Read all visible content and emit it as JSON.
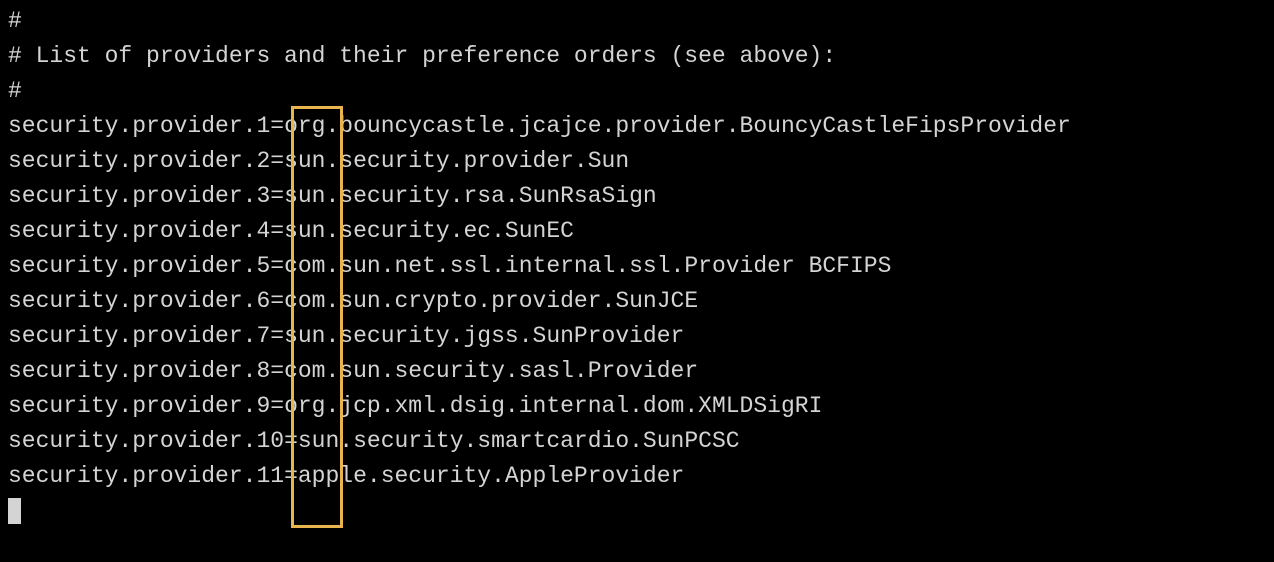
{
  "comments": {
    "line1": "#",
    "line2": "# List of providers and their preference orders (see above):",
    "line3": "#"
  },
  "providers": [
    {
      "key": "security.provider.",
      "num": "1",
      "sep": "=",
      "value": "org.bouncycastle.jcajce.provider.BouncyCastleFipsProvider"
    },
    {
      "key": "security.provider.",
      "num": "2",
      "sep": "=",
      "value": "sun.security.provider.Sun"
    },
    {
      "key": "security.provider.",
      "num": "3",
      "sep": "=",
      "value": "sun.security.rsa.SunRsaSign"
    },
    {
      "key": "security.provider.",
      "num": "4",
      "sep": "=",
      "value": "sun.security.ec.SunEC"
    },
    {
      "key": "security.provider.",
      "num": "5",
      "sep": "=",
      "value": "com.sun.net.ssl.internal.ssl.Provider BCFIPS"
    },
    {
      "key": "security.provider.",
      "num": "6",
      "sep": "=",
      "value": "com.sun.crypto.provider.SunJCE"
    },
    {
      "key": "security.provider.",
      "num": "7",
      "sep": "=",
      "value": "sun.security.jgss.SunProvider"
    },
    {
      "key": "security.provider.",
      "num": "8",
      "sep": "=",
      "value": "com.sun.security.sasl.Provider"
    },
    {
      "key": "security.provider.",
      "num": "9",
      "sep": "=",
      "value": "org.jcp.xml.dsig.internal.dom.XMLDSigRI"
    },
    {
      "key": "security.provider.",
      "num": "10",
      "sep": "=",
      "value": "sun.security.smartcardio.SunPCSC"
    },
    {
      "key": "security.provider.",
      "num": "11",
      "sep": "=",
      "value": "apple.security.AppleProvider"
    }
  ]
}
